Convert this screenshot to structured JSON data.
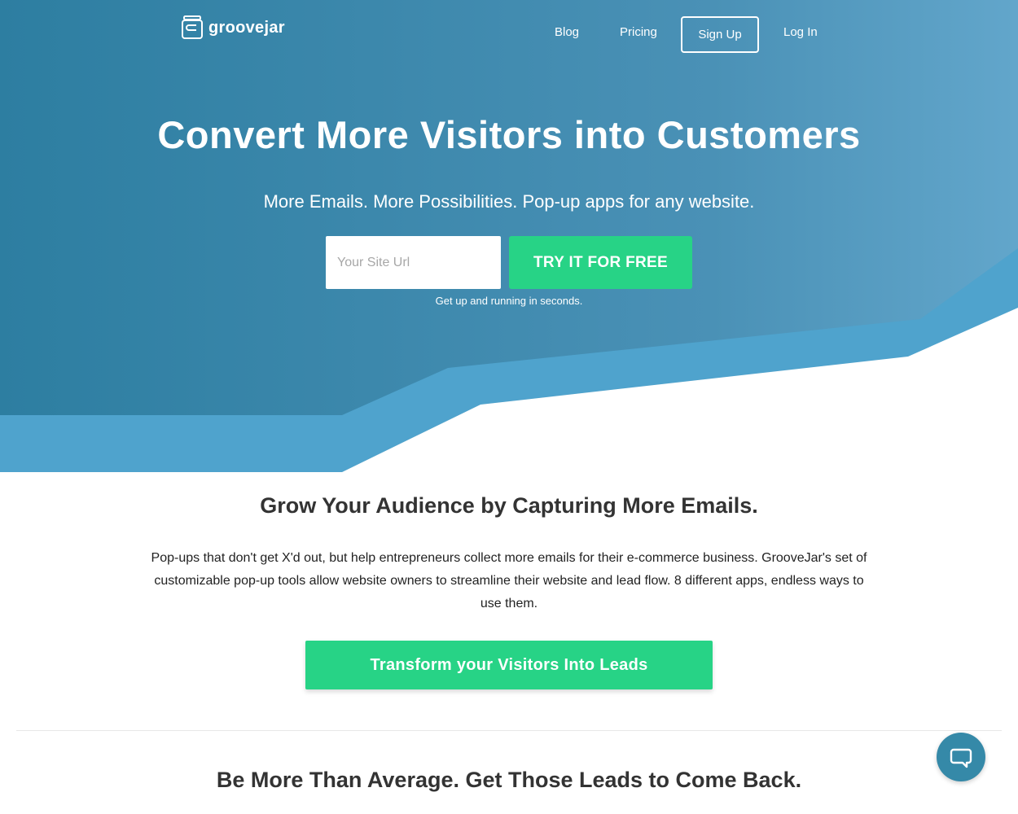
{
  "brand": {
    "name": "groovejar",
    "primary_color": "#2f7fa3",
    "accent_color": "#27d386",
    "light_blue": "#4fa3cd"
  },
  "nav": {
    "items": [
      {
        "label": "Blog"
      },
      {
        "label": "Pricing"
      },
      {
        "label": "Log In"
      }
    ],
    "signup_label": "Sign Up"
  },
  "hero": {
    "title": "Convert More Visitors into Customers",
    "subtitle": "More Emails. More Possibilities. Pop-up apps for any website.",
    "url_placeholder": "Your Site Url",
    "cta_label": "TRY IT FOR FREE",
    "note": "Get up and running in seconds."
  },
  "section1": {
    "title": "Grow Your Audience by Capturing More Emails.",
    "body": "Pop-ups that don't get X'd out, but help entrepreneurs collect more emails for their e-commerce business. GrooveJar's set of customizable pop-up tools allow website owners to streamline their website and lead flow. 8 different apps, endless ways to use them.",
    "cta_label": "Transform your Visitors Into Leads"
  },
  "section2": {
    "title": "Be More Than Average. Get Those Leads to Come Back."
  },
  "chat": {
    "icon": "chat-bubble-icon"
  }
}
